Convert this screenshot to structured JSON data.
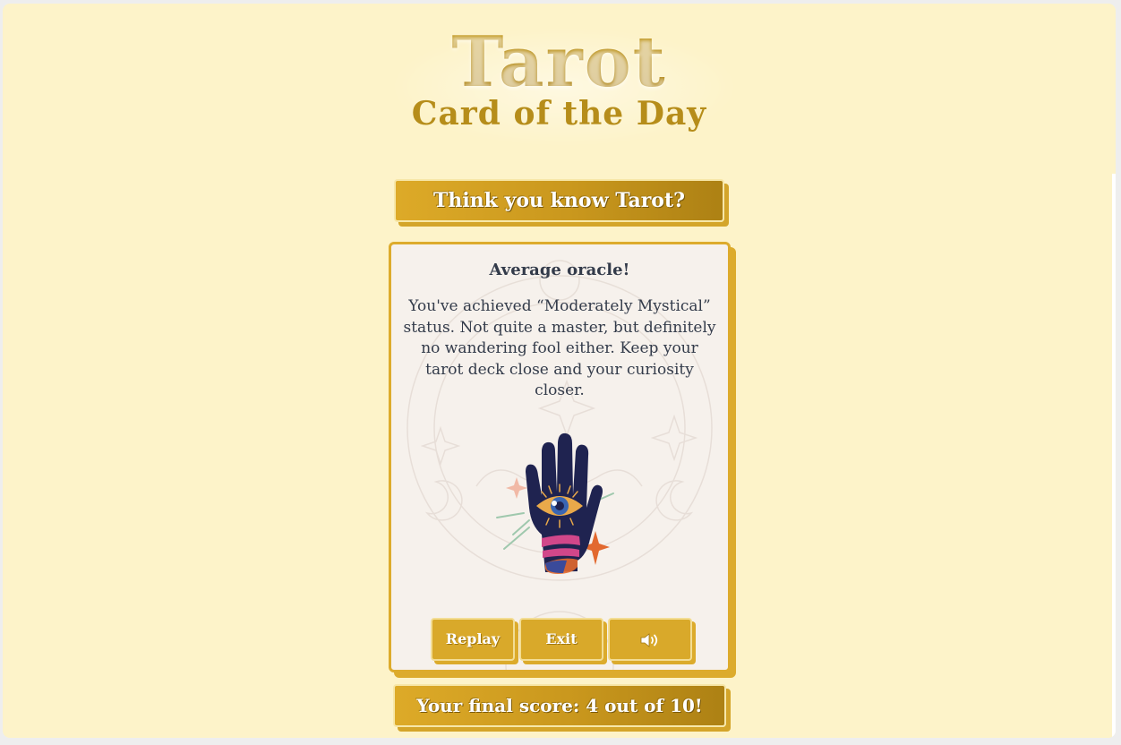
{
  "logo": {
    "title": "Tarot",
    "subtitle": "Card of the Day"
  },
  "quiz_banner": {
    "label": "Think you know Tarot?"
  },
  "result": {
    "heading": "Average oracle!",
    "message": "You've achieved “Moderately Mystical” status. Not quite a master, but definitely no wandering fool either. Keep your tarot deck close and your curiosity closer.",
    "illustration": "hand-with-eye-icon"
  },
  "buttons": {
    "replay": "Replay",
    "exit": "Exit",
    "sound_icon": "speaker-icon"
  },
  "score_banner": {
    "label": "Your final score: 4 out of 10!"
  },
  "colors": {
    "background": "#fdf3c9",
    "gold": "#d9a92a",
    "card": "#f6f1ec",
    "text": "#333b4a"
  }
}
